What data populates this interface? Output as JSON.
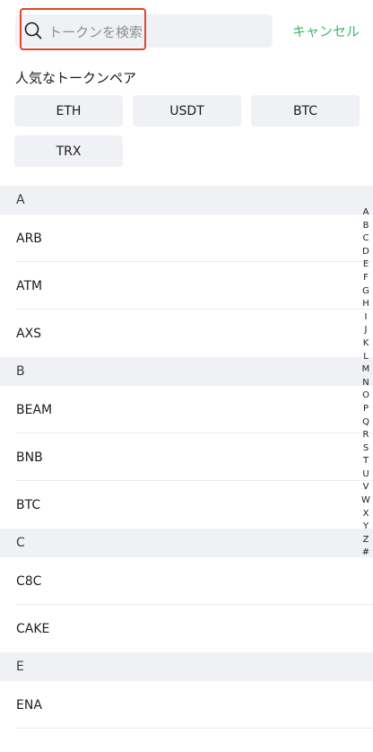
{
  "search": {
    "placeholder": "トークンを検索",
    "cancel_label": "キャンセル"
  },
  "popular": {
    "title": "人気なトークンペア",
    "pairs": [
      "ETH",
      "USDT",
      "BTC",
      "TRX"
    ]
  },
  "sections": [
    {
      "letter": "A",
      "tokens": [
        "ARB",
        "ATM",
        "AXS"
      ]
    },
    {
      "letter": "B",
      "tokens": [
        "BEAM",
        "BNB",
        "BTC"
      ]
    },
    {
      "letter": "C",
      "tokens": [
        "C8C",
        "CAKE"
      ]
    },
    {
      "letter": "E",
      "tokens": [
        "ENA"
      ]
    }
  ],
  "alpha_index": [
    "A",
    "B",
    "C",
    "D",
    "E",
    "F",
    "G",
    "H",
    "I",
    "J",
    "K",
    "L",
    "M",
    "N",
    "O",
    "P",
    "Q",
    "R",
    "S",
    "T",
    "U",
    "V",
    "W",
    "X",
    "Y",
    "Z",
    "#"
  ],
  "colors": {
    "accent": "#3dba6b",
    "highlight_border": "#e0442c",
    "chip_bg": "#f0f1f4",
    "section_bg": "#f0f1f4"
  }
}
